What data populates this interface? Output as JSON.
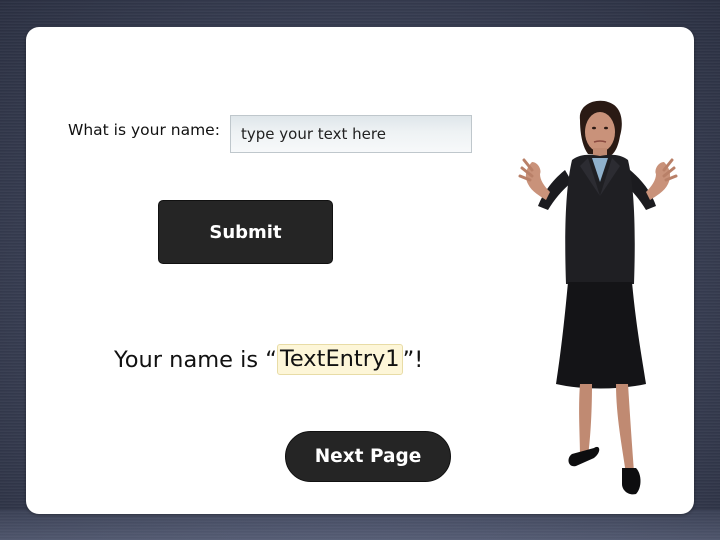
{
  "form": {
    "name_label": "What is your name:",
    "name_input": {
      "value": "",
      "placeholder": "type your text here"
    },
    "submit_label": "Submit"
  },
  "result": {
    "prefix": "Your name is “",
    "variable": "TextEntry1",
    "suffix": "”!"
  },
  "navigation": {
    "next_label": "Next Page"
  },
  "colors": {
    "button_bg": "#252525",
    "card_bg": "#ffffff",
    "variable_highlight": "#fdf6d8",
    "backdrop": "#3d4358"
  }
}
